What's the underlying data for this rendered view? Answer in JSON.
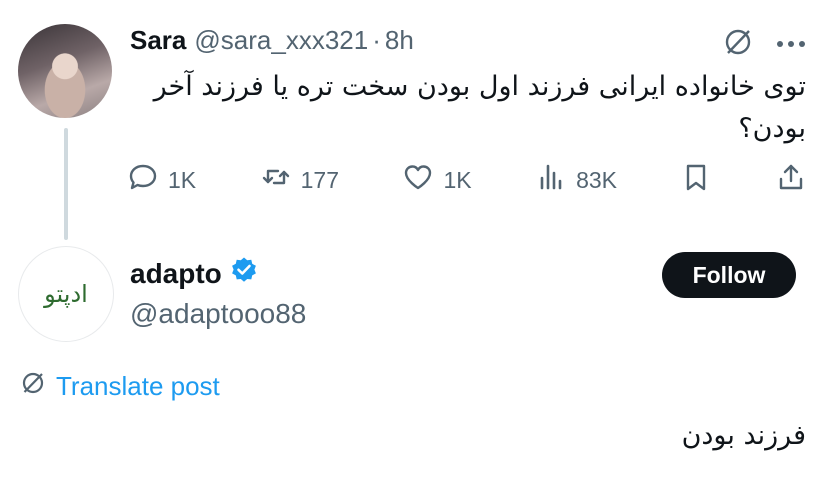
{
  "parent_tweet": {
    "author_name": "Sara",
    "handle": "@sara_xxx321",
    "separator": "·",
    "time": "8h",
    "text": "توی خانواده ایرانی فرزند اول بودن سخت تره یا فرزند آخر بودن؟",
    "icons": {
      "translate": "translate-icon",
      "more": "more-icon"
    },
    "actions": [
      {
        "icon": "reply-icon",
        "count": "1K"
      },
      {
        "icon": "retweet-icon",
        "count": "177"
      },
      {
        "icon": "like-icon",
        "count": "1K"
      },
      {
        "icon": "views-icon",
        "count": "83K"
      },
      {
        "icon": "bookmark-icon",
        "count": ""
      },
      {
        "icon": "share-icon",
        "count": ""
      }
    ]
  },
  "reply_tweet": {
    "author_name": "adapto",
    "handle": "@adaptooo88",
    "verified": true,
    "logo_text": "ادپتو",
    "follow_label": "Follow",
    "translate_label": "Translate post",
    "text": "فرزند بودن"
  },
  "colors": {
    "text": "#0f1419",
    "muted": "#536471",
    "accent": "#1d9bf0",
    "follow_bg": "#0f1419",
    "thread_line": "#cfd9de"
  }
}
